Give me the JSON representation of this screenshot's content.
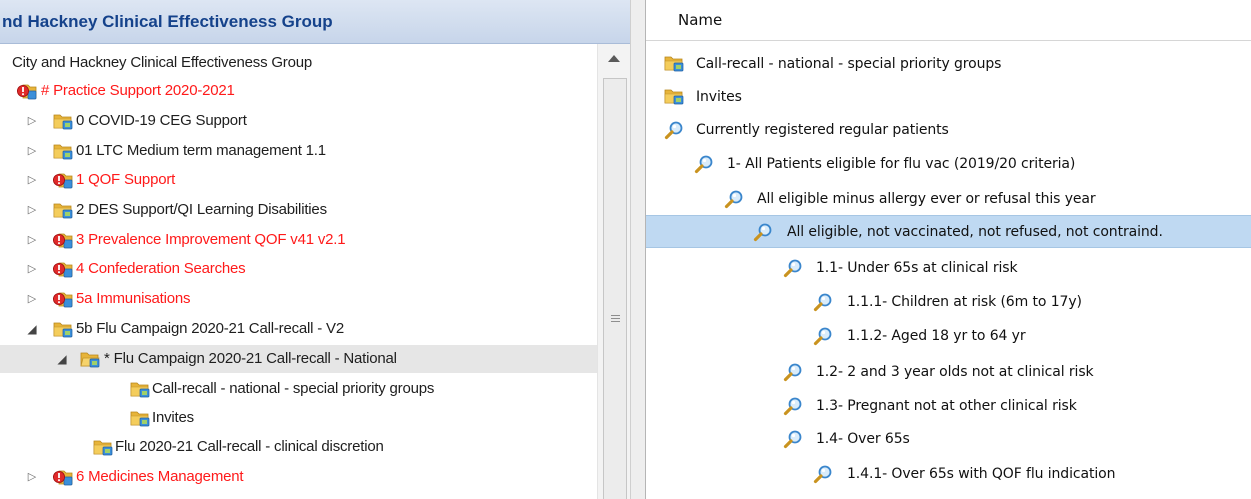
{
  "left_panel": {
    "header_title": "nd Hackney Clinical Effectiveness Group",
    "tree_items": [
      {
        "label": "City and Hackney Clinical Effectiveness Group",
        "icon": "none",
        "color": "black",
        "toggle": "none"
      },
      {
        "label": "# Practice Support 2020-2021",
        "icon": "folder-alert-icon",
        "color": "red",
        "toggle": "none"
      },
      {
        "label": "0 COVID-19 CEG Support",
        "icon": "folder-icon",
        "color": "black",
        "toggle": "collapsed"
      },
      {
        "label": "01 LTC Medium term management 1.1",
        "icon": "folder-icon",
        "color": "black",
        "toggle": "collapsed"
      },
      {
        "label": "1 QOF Support",
        "icon": "folder-alert-icon",
        "color": "red",
        "toggle": "collapsed"
      },
      {
        "label": "2 DES Support/QI Learning Disabilities",
        "icon": "folder-icon",
        "color": "black",
        "toggle": "collapsed"
      },
      {
        "label": "3 Prevalence Improvement QOF v41 v2.1",
        "icon": "folder-alert-icon",
        "color": "red",
        "toggle": "collapsed"
      },
      {
        "label": "4 Confederation Searches",
        "icon": "folder-alert-icon",
        "color": "red",
        "toggle": "collapsed"
      },
      {
        "label": "5a Immunisations",
        "icon": "folder-alert-icon",
        "color": "red",
        "toggle": "collapsed"
      },
      {
        "label": "5b Flu Campaign 2020-21 Call-recall - V2",
        "icon": "folder-icon",
        "color": "black",
        "toggle": "expanded"
      },
      {
        "label": "* Flu Campaign 2020-21 Call-recall - National",
        "icon": "folder-open-icon",
        "color": "black",
        "toggle": "expanded",
        "selected": true
      },
      {
        "label": "Call-recall - national - special priority groups",
        "icon": "folder-icon",
        "color": "black",
        "toggle": "none"
      },
      {
        "label": "Invites",
        "icon": "folder-icon",
        "color": "black",
        "toggle": "none"
      },
      {
        "label": "Flu 2020-21 Call-recall - clinical discretion",
        "icon": "folder-icon",
        "color": "black",
        "toggle": "none"
      },
      {
        "label": "6 Medicines Management",
        "icon": "folder-alert-icon",
        "color": "red",
        "toggle": "collapsed"
      }
    ]
  },
  "right_panel": {
    "column_header": "Name",
    "items": [
      {
        "label": "Call-recall - national - special priority groups",
        "icon": "folder-icon"
      },
      {
        "label": "Invites",
        "icon": "folder-icon"
      },
      {
        "label": "Currently registered regular patients",
        "icon": "search-icon"
      },
      {
        "label": "1- All Patients eligible for flu vac (2019/20 criteria)",
        "icon": "search-icon"
      },
      {
        "label": "All eligible minus allergy ever or refusal this year",
        "icon": "search-icon"
      },
      {
        "label": "All eligible, not vaccinated, not refused, not contraind.",
        "icon": "search-icon",
        "selected": true
      },
      {
        "label": "1.1- Under 65s at clinical risk",
        "icon": "search-icon"
      },
      {
        "label": "1.1.1- Children at risk (6m to 17y)",
        "icon": "search-icon"
      },
      {
        "label": "1.1.2- Aged 18 yr to 64 yr",
        "icon": "search-icon"
      },
      {
        "label": "1.2- 2 and 3 year olds not at clinical risk",
        "icon": "search-icon"
      },
      {
        "label": "1.3- Pregnant not at other clinical risk",
        "icon": "search-icon"
      },
      {
        "label": "1.4- Over 65s",
        "icon": "search-icon"
      },
      {
        "label": "1.4.1- Over 65s with QOF flu indication",
        "icon": "search-icon"
      }
    ]
  },
  "colors": {
    "header_text": "#15428b",
    "red_label": "#ff1a1a",
    "selected_row": "#bfd9f2",
    "tree_selected": "#e6e6e6"
  }
}
